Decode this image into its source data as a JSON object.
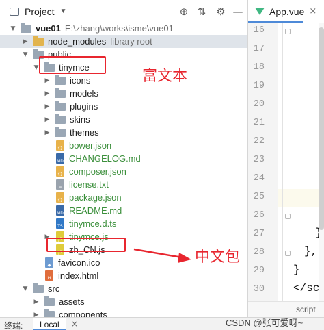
{
  "project_panel": {
    "title": "Project",
    "tools": {
      "locate": "⊕",
      "collapse": "⇅",
      "settings": "⚙",
      "hide": "—"
    }
  },
  "tree": [
    {
      "label": "vue01",
      "secondary": "E:\\zhang\\works\\isme\\vue01",
      "type": "root",
      "expanded": true
    },
    {
      "label": "node_modules",
      "secondary": "library root",
      "type": "folder-yellow",
      "expanded": false
    },
    {
      "label": "public",
      "type": "folder",
      "expanded": true
    },
    {
      "label": "tinymce",
      "type": "folder",
      "expanded": true
    },
    {
      "label": "icons",
      "type": "folder",
      "expanded": false
    },
    {
      "label": "models",
      "type": "folder",
      "expanded": false
    },
    {
      "label": "plugins",
      "type": "folder",
      "expanded": false
    },
    {
      "label": "skins",
      "type": "folder",
      "expanded": false
    },
    {
      "label": "themes",
      "type": "folder",
      "expanded": false
    },
    {
      "label": "bower.json",
      "type": "json",
      "tag": "{}"
    },
    {
      "label": "CHANGELOG.md",
      "type": "md",
      "tag": "MD"
    },
    {
      "label": "composer.json",
      "type": "json",
      "tag": "{}"
    },
    {
      "label": "license.txt",
      "type": "txt",
      "tag": "≡"
    },
    {
      "label": "package.json",
      "type": "json",
      "tag": "{}"
    },
    {
      "label": "README.md",
      "type": "md",
      "tag": "MD"
    },
    {
      "label": "tinymce.d.ts",
      "type": "ts",
      "tag": "TS"
    },
    {
      "label": "tinymce.js",
      "type": "js",
      "tag": "JS",
      "expanded": false
    },
    {
      "label": "zh_CN.js",
      "type": "js",
      "tag": "JS"
    },
    {
      "label": "favicon.ico",
      "type": "ico",
      "tag": "◆"
    },
    {
      "label": "index.html",
      "type": "html",
      "tag": "H"
    },
    {
      "label": "src",
      "type": "folder",
      "expanded": true
    },
    {
      "label": "assets",
      "type": "folder",
      "expanded": false
    },
    {
      "label": "components",
      "type": "folder",
      "expanded": false
    }
  ],
  "annotations": {
    "rich_text": "富文本",
    "chinese_pack": "中文包"
  },
  "editor": {
    "tab_name": "App.vue",
    "tab_close": "×",
    "line_numbers": [
      "16",
      "17",
      "18",
      "19",
      "20",
      "21",
      "22",
      "23",
      "24",
      "25",
      "26",
      "27",
      "28",
      "29",
      "30"
    ],
    "current_line": "25",
    "code_lines": [
      "}",
      "},",
      "}",
      "</scri"
    ],
    "breadcrumb": "script"
  },
  "bottom_bar": {
    "terminal_label": "终端:",
    "tab_label": "Local",
    "tab_close": "×"
  },
  "watermark": "CSDN @张可爱呀~"
}
